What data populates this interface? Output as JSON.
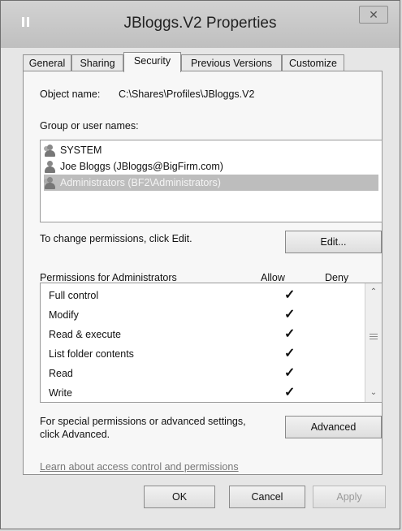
{
  "window": {
    "title": "JBloggs.V2 Properties",
    "close_glyph": "✕"
  },
  "tabs": [
    {
      "label": "General"
    },
    {
      "label": "Sharing"
    },
    {
      "label": "Security"
    },
    {
      "label": "Previous Versions"
    },
    {
      "label": "Customize"
    }
  ],
  "object": {
    "label": "Object name:",
    "value": "C:\\Shares\\Profiles\\JBloggs.V2"
  },
  "users": {
    "heading": "Group or user names:",
    "items": [
      {
        "name": "SYSTEM",
        "icon": "user-group-icon"
      },
      {
        "name": "Joe Bloggs (JBloggs@BigFirm.com)",
        "icon": "user-icon"
      },
      {
        "name": "Administrators (BF2\\Administrators)",
        "icon": "user-group-icon",
        "selected": true
      }
    ]
  },
  "change_text": "To change permissions, click Edit.",
  "edit_button": "Edit...",
  "permissions": {
    "heading": "Permissions for Administrators",
    "allow_header": "Allow",
    "deny_header": "Deny",
    "check_glyph": "✓",
    "rows": [
      {
        "name": "Full control",
        "allow": true,
        "deny": false
      },
      {
        "name": "Modify",
        "allow": true,
        "deny": false
      },
      {
        "name": "Read & execute",
        "allow": true,
        "deny": false
      },
      {
        "name": "List folder contents",
        "allow": true,
        "deny": false
      },
      {
        "name": "Read",
        "allow": true,
        "deny": false
      },
      {
        "name": "Write",
        "allow": true,
        "deny": false
      }
    ]
  },
  "special": {
    "line1": "For special permissions or advanced settings,",
    "line2": "click Advanced.",
    "button": "Advanced"
  },
  "learn_link": "Learn about access control and permissions",
  "buttons": {
    "ok": "OK",
    "cancel": "Cancel",
    "apply": "Apply"
  }
}
